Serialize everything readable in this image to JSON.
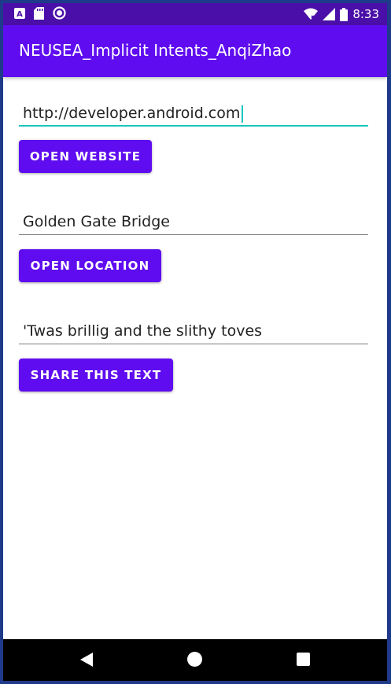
{
  "status_bar": {
    "time": "8:33",
    "icons": [
      "a-notification-icon",
      "sd-card-icon",
      "sync-icon",
      "wifi-icon",
      "signal-icon",
      "battery-icon"
    ]
  },
  "app_bar": {
    "title": "NEUSEA_Implicit Intents_AnqiZhao"
  },
  "website": {
    "value": "http://developer.android.com",
    "button_label": "OPEN WEBSITE"
  },
  "location": {
    "value": "Golden Gate Bridge",
    "button_label": "OPEN LOCATION"
  },
  "share": {
    "value": "'Twas brillig and the slithy toves",
    "button_label": "SHARE THIS TEXT"
  },
  "colors": {
    "status_bar": "#4a0fa8",
    "primary": "#5f0df0",
    "accent": "#17c6c0"
  },
  "nav_bar": {
    "icons": [
      "back-icon",
      "home-icon",
      "recents-icon"
    ]
  }
}
